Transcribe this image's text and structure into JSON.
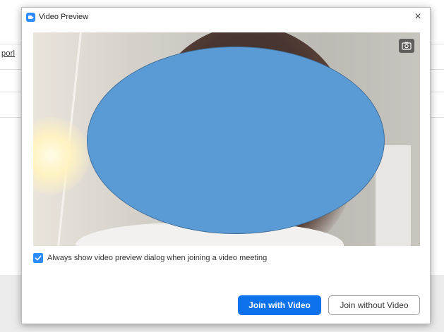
{
  "background": {
    "link_text": "porl"
  },
  "dialog": {
    "title": "Video Preview",
    "close_glyph": "×",
    "icons": {
      "app": "zoom-app-icon",
      "close": "close-icon",
      "camera": "camera-switch-icon",
      "check": "check-icon"
    },
    "checkbox": {
      "checked": true,
      "label": "Always show video preview dialog when joining a video meeting"
    },
    "buttons": {
      "join_with_video": "Join with Video",
      "join_without_video": "Join without Video"
    },
    "colors": {
      "accent": "#0e72ed",
      "privacy_overlay": "#5b9bd5"
    }
  }
}
